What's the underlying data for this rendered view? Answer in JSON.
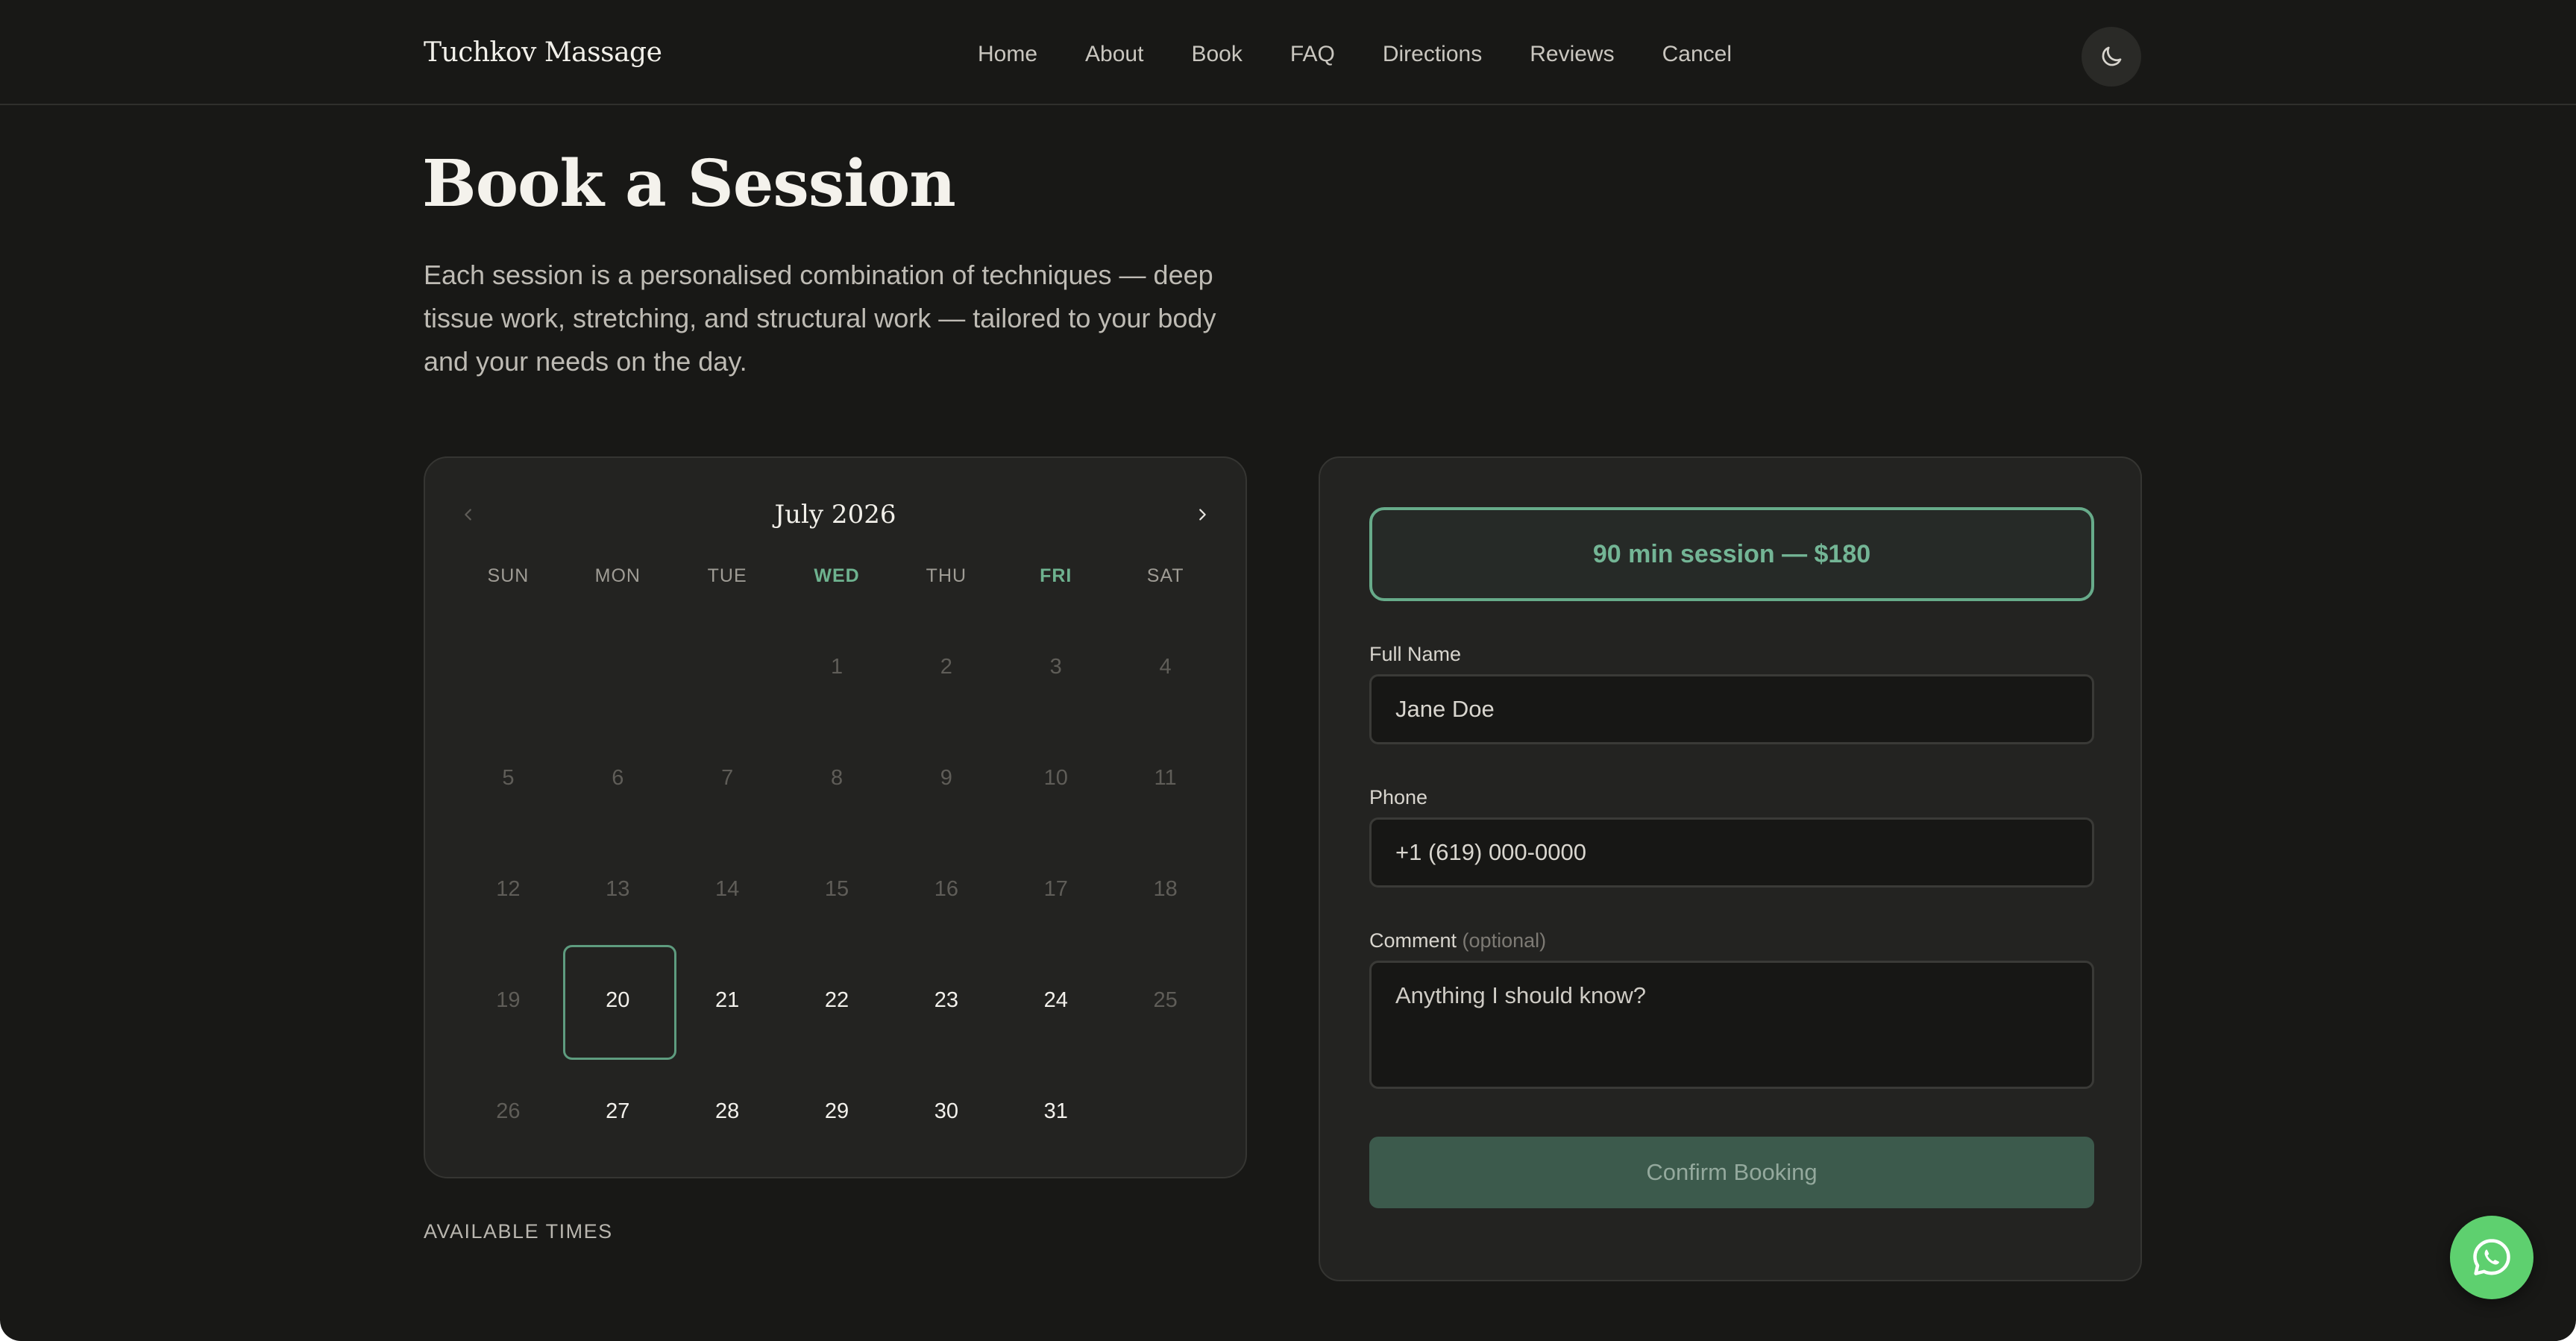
{
  "header": {
    "brand": "Tuchkov Massage",
    "nav": [
      "Home",
      "About",
      "Book",
      "FAQ",
      "Directions",
      "Reviews",
      "Cancel"
    ],
    "theme_icon": "moon-icon"
  },
  "page": {
    "title": "Book a Session",
    "intro": "Each session is a personalised combination of techniques — deep tissue work, stretching, and structural work — tailored to your body and your needs on the day."
  },
  "calendar": {
    "month": "July 2026",
    "prev_icon": "chevron-left-icon",
    "next_icon": "chevron-right-icon",
    "weekdays": [
      "SUN",
      "MON",
      "TUE",
      "WED",
      "THU",
      "FRI",
      "SAT"
    ],
    "highlighted_weekdays": [
      "WED",
      "FRI"
    ],
    "weeks": [
      [
        "",
        "",
        "",
        "1",
        "2",
        "3",
        "4"
      ],
      [
        "5",
        "6",
        "7",
        "8",
        "9",
        "10",
        "11"
      ],
      [
        "12",
        "13",
        "14",
        "15",
        "16",
        "17",
        "18"
      ],
      [
        "19",
        "20",
        "21",
        "22",
        "23",
        "24",
        "25"
      ],
      [
        "26",
        "27",
        "28",
        "29",
        "30",
        "31",
        ""
      ]
    ],
    "available_days": [
      "20",
      "21",
      "22",
      "23",
      "24",
      "27",
      "28",
      "29",
      "30",
      "31"
    ],
    "selected_day": "20",
    "accent_color": "#5e9c7f"
  },
  "available_times_label": "AVAILABLE TIMES",
  "form": {
    "session_option": "90 min session — $180",
    "name_label": "Full Name",
    "name_value": "Jane Doe",
    "phone_label": "Phone",
    "phone_value": "+1 (619) 000-0000",
    "comment_label": "Comment",
    "comment_optional": "(optional)",
    "comment_placeholder": "Anything I should know?",
    "confirm_label": "Confirm Booking"
  },
  "floating": {
    "whatsapp_icon": "whatsapp-icon"
  }
}
